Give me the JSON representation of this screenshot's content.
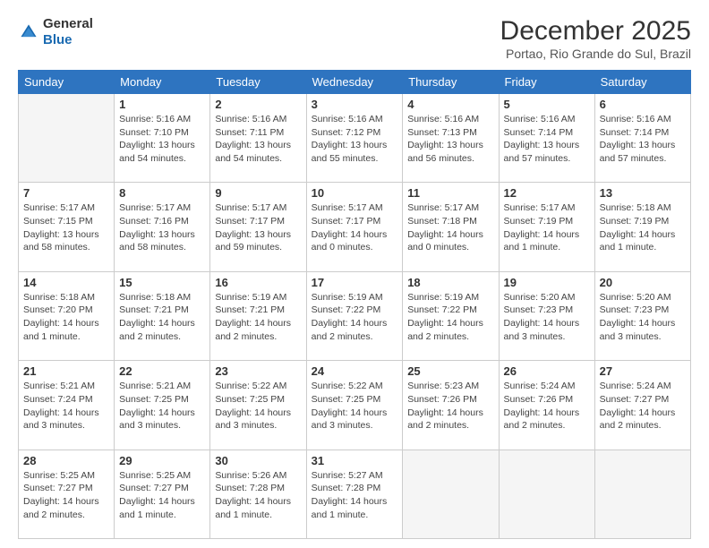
{
  "header": {
    "logo_general": "General",
    "logo_blue": "Blue",
    "month_title": "December 2025",
    "location": "Portao, Rio Grande do Sul, Brazil"
  },
  "weekdays": [
    "Sunday",
    "Monday",
    "Tuesday",
    "Wednesday",
    "Thursday",
    "Friday",
    "Saturday"
  ],
  "weeks": [
    [
      {
        "num": "",
        "empty": true
      },
      {
        "num": "1",
        "sunrise": "5:16 AM",
        "sunset": "7:10 PM",
        "daylight": "13 hours and 54 minutes."
      },
      {
        "num": "2",
        "sunrise": "5:16 AM",
        "sunset": "7:11 PM",
        "daylight": "13 hours and 54 minutes."
      },
      {
        "num": "3",
        "sunrise": "5:16 AM",
        "sunset": "7:12 PM",
        "daylight": "13 hours and 55 minutes."
      },
      {
        "num": "4",
        "sunrise": "5:16 AM",
        "sunset": "7:13 PM",
        "daylight": "13 hours and 56 minutes."
      },
      {
        "num": "5",
        "sunrise": "5:16 AM",
        "sunset": "7:14 PM",
        "daylight": "13 hours and 57 minutes."
      },
      {
        "num": "6",
        "sunrise": "5:16 AM",
        "sunset": "7:14 PM",
        "daylight": "13 hours and 57 minutes."
      }
    ],
    [
      {
        "num": "7",
        "sunrise": "5:17 AM",
        "sunset": "7:15 PM",
        "daylight": "13 hours and 58 minutes."
      },
      {
        "num": "8",
        "sunrise": "5:17 AM",
        "sunset": "7:16 PM",
        "daylight": "13 hours and 58 minutes."
      },
      {
        "num": "9",
        "sunrise": "5:17 AM",
        "sunset": "7:17 PM",
        "daylight": "13 hours and 59 minutes."
      },
      {
        "num": "10",
        "sunrise": "5:17 AM",
        "sunset": "7:17 PM",
        "daylight": "14 hours and 0 minutes."
      },
      {
        "num": "11",
        "sunrise": "5:17 AM",
        "sunset": "7:18 PM",
        "daylight": "14 hours and 0 minutes."
      },
      {
        "num": "12",
        "sunrise": "5:17 AM",
        "sunset": "7:19 PM",
        "daylight": "14 hours and 1 minute."
      },
      {
        "num": "13",
        "sunrise": "5:18 AM",
        "sunset": "7:19 PM",
        "daylight": "14 hours and 1 minute."
      }
    ],
    [
      {
        "num": "14",
        "sunrise": "5:18 AM",
        "sunset": "7:20 PM",
        "daylight": "14 hours and 1 minute."
      },
      {
        "num": "15",
        "sunrise": "5:18 AM",
        "sunset": "7:21 PM",
        "daylight": "14 hours and 2 minutes."
      },
      {
        "num": "16",
        "sunrise": "5:19 AM",
        "sunset": "7:21 PM",
        "daylight": "14 hours and 2 minutes."
      },
      {
        "num": "17",
        "sunrise": "5:19 AM",
        "sunset": "7:22 PM",
        "daylight": "14 hours and 2 minutes."
      },
      {
        "num": "18",
        "sunrise": "5:19 AM",
        "sunset": "7:22 PM",
        "daylight": "14 hours and 2 minutes."
      },
      {
        "num": "19",
        "sunrise": "5:20 AM",
        "sunset": "7:23 PM",
        "daylight": "14 hours and 3 minutes."
      },
      {
        "num": "20",
        "sunrise": "5:20 AM",
        "sunset": "7:23 PM",
        "daylight": "14 hours and 3 minutes."
      }
    ],
    [
      {
        "num": "21",
        "sunrise": "5:21 AM",
        "sunset": "7:24 PM",
        "daylight": "14 hours and 3 minutes."
      },
      {
        "num": "22",
        "sunrise": "5:21 AM",
        "sunset": "7:25 PM",
        "daylight": "14 hours and 3 minutes."
      },
      {
        "num": "23",
        "sunrise": "5:22 AM",
        "sunset": "7:25 PM",
        "daylight": "14 hours and 3 minutes."
      },
      {
        "num": "24",
        "sunrise": "5:22 AM",
        "sunset": "7:25 PM",
        "daylight": "14 hours and 3 minutes."
      },
      {
        "num": "25",
        "sunrise": "5:23 AM",
        "sunset": "7:26 PM",
        "daylight": "14 hours and 2 minutes."
      },
      {
        "num": "26",
        "sunrise": "5:24 AM",
        "sunset": "7:26 PM",
        "daylight": "14 hours and 2 minutes."
      },
      {
        "num": "27",
        "sunrise": "5:24 AM",
        "sunset": "7:27 PM",
        "daylight": "14 hours and 2 minutes."
      }
    ],
    [
      {
        "num": "28",
        "sunrise": "5:25 AM",
        "sunset": "7:27 PM",
        "daylight": "14 hours and 2 minutes."
      },
      {
        "num": "29",
        "sunrise": "5:25 AM",
        "sunset": "7:27 PM",
        "daylight": "14 hours and 1 minute."
      },
      {
        "num": "30",
        "sunrise": "5:26 AM",
        "sunset": "7:28 PM",
        "daylight": "14 hours and 1 minute."
      },
      {
        "num": "31",
        "sunrise": "5:27 AM",
        "sunset": "7:28 PM",
        "daylight": "14 hours and 1 minute."
      },
      {
        "num": "",
        "empty": true
      },
      {
        "num": "",
        "empty": true
      },
      {
        "num": "",
        "empty": true
      }
    ]
  ],
  "labels": {
    "sunrise": "Sunrise:",
    "sunset": "Sunset:",
    "daylight": "Daylight:"
  }
}
